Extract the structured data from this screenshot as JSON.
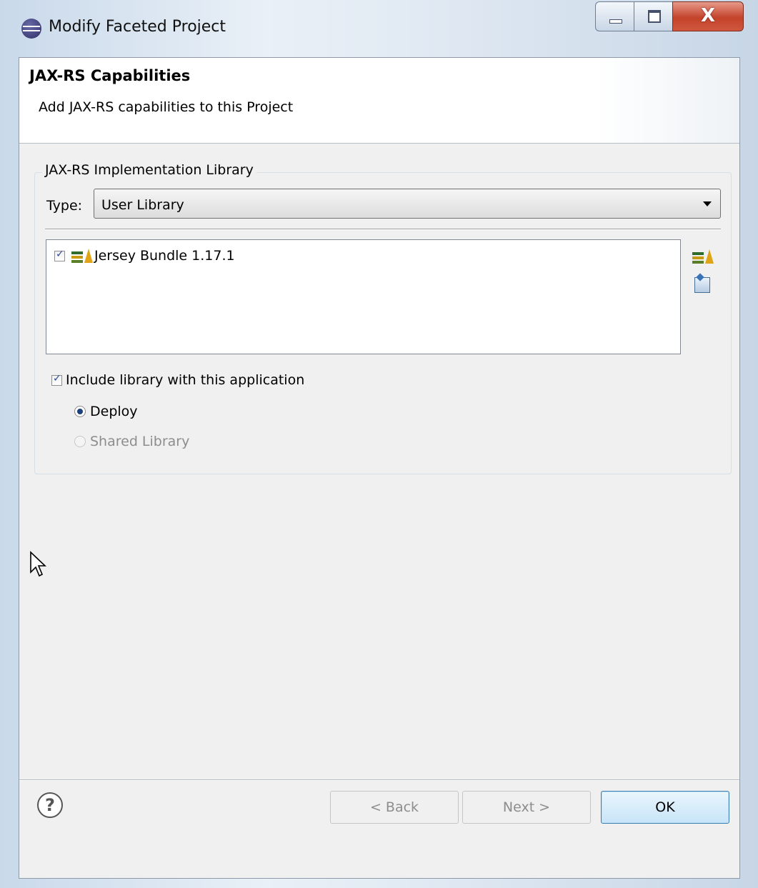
{
  "window": {
    "title": "Modify Faceted Project",
    "controls": {
      "minimize": "minimize",
      "maximize": "maximize",
      "close_glyph": "X"
    }
  },
  "header": {
    "title": "JAX-RS Capabilities",
    "description": "Add JAX-RS capabilities to this Project"
  },
  "library_group": {
    "legend": "JAX-RS Implementation Library",
    "type_label": "Type:",
    "type_value": "User Library",
    "libraries": [
      {
        "label": "Jersey Bundle 1.17.1",
        "checked": true
      }
    ],
    "include_label": "Include library with this application",
    "include_checked": true,
    "radio_options": [
      {
        "label": "Deploy",
        "selected": true,
        "enabled": true
      },
      {
        "label": "Shared Library",
        "selected": false,
        "enabled": false
      }
    ]
  },
  "footer": {
    "help_glyph": "?",
    "back_label": "< Back",
    "next_label": "Next >",
    "ok_label": "OK"
  }
}
